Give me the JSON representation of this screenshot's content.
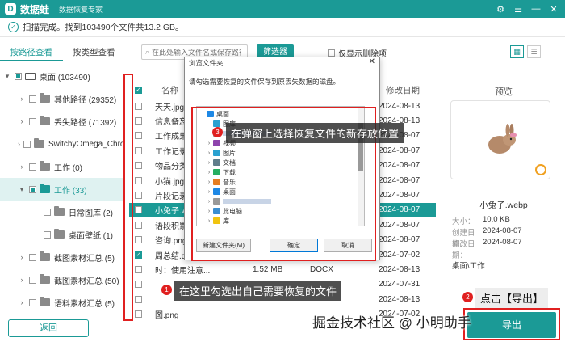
{
  "app": {
    "logo": "D",
    "name": "数据蛙",
    "subtitle": "数据恢复专家"
  },
  "window_controls": [
    "⚙",
    "☰",
    "—",
    "✕"
  ],
  "status": {
    "text": "扫描完成。找到103490个文件共13.2 GB。"
  },
  "tabs": [
    {
      "label": "按路径查看",
      "active": true
    },
    {
      "label": "按类型查看",
      "active": false
    }
  ],
  "tree": [
    {
      "label": "桌面 (103490)",
      "chev": "▾",
      "indent": 0,
      "icon": "pc",
      "check": "partial",
      "sel": false
    },
    {
      "label": "其他路径 (29352)",
      "chev": "›",
      "indent": 1,
      "icon": "folder",
      "check": "none",
      "sel": false
    },
    {
      "label": "丢失路径 (71392)",
      "chev": "›",
      "indent": 1,
      "icon": "folder",
      "check": "none",
      "sel": false
    },
    {
      "label": "SwitchyOmega_Chromium",
      "chev": "›",
      "indent": 1,
      "icon": "folder",
      "check": "none",
      "sel": false
    },
    {
      "label": "工作 (0)",
      "chev": "›",
      "indent": 1,
      "icon": "folder",
      "check": "none",
      "sel": false
    },
    {
      "label": "工作 (33)",
      "chev": "▾",
      "indent": 1,
      "icon": "folder-teal",
      "check": "partial",
      "sel": true
    },
    {
      "label": "日常图库 (2)",
      "chev": "",
      "indent": 2,
      "icon": "folder",
      "check": "none",
      "sel": false
    },
    {
      "label": "桌面壁纸 (1)",
      "chev": "",
      "indent": 2,
      "icon": "folder",
      "check": "none",
      "sel": false
    },
    {
      "label": "截图素材汇总 (5)",
      "chev": "›",
      "indent": 1,
      "icon": "folder",
      "check": "none",
      "sel": false
    },
    {
      "label": "截图素材汇总 (50)",
      "chev": "›",
      "indent": 1,
      "icon": "folder",
      "check": "none",
      "sel": false
    },
    {
      "label": "语料素材汇总 (5)",
      "chev": "›",
      "indent": 1,
      "icon": "folder",
      "check": "none",
      "sel": false
    }
  ],
  "back_label": "返回",
  "toolbar": {
    "search_placeholder": "在此处输入文件名或保存路径",
    "filter_label": "筛选器",
    "deleted_only_label": "仅显示删除项"
  },
  "columns": {
    "name": "名称",
    "date": "修改日期"
  },
  "files": [
    {
      "name": "天天.jpg",
      "size": "",
      "type": "",
      "date": "2024-08-13",
      "checked": false,
      "sel": false
    },
    {
      "name": "信息备忘.txt",
      "size": "",
      "type": "",
      "date": "2024-08-13",
      "checked": false,
      "sel": false
    },
    {
      "name": "工作成果分析.xlsx",
      "size": "",
      "type": "",
      "date": "2024-08-07",
      "checked": false,
      "sel": false
    },
    {
      "name": "工作记录表.xlsx",
      "size": "",
      "type": "",
      "date": "2024-08-07",
      "checked": false,
      "sel": false
    },
    {
      "name": "物品分类.docx",
      "size": "",
      "type": "",
      "date": "2024-08-07",
      "checked": false,
      "sel": false
    },
    {
      "name": "小猫.jpg",
      "size": "",
      "type": "",
      "date": "2024-08-07",
      "checked": false,
      "sel": false
    },
    {
      "name": "片段记录.docx",
      "size": "",
      "type": "",
      "date": "2024-08-07",
      "checked": false,
      "sel": false
    },
    {
      "name": "小兔子.webp",
      "size": "",
      "type": "",
      "date": "2024-08-07",
      "checked": false,
      "sel": true
    },
    {
      "name": "语段积累.docx",
      "size": "",
      "type": "",
      "date": "2024-08-07",
      "checked": false,
      "sel": false
    },
    {
      "name": "咨询.png",
      "size": "",
      "type": "",
      "date": "2024-08-07",
      "checked": false,
      "sel": false
    },
    {
      "name": "周总结.docx",
      "size": "1.52 MB",
      "type": "DOCX",
      "date": "2024-07-02",
      "checked": true,
      "sel": false
    },
    {
      "name": "时：使用注意...",
      "size": "1.52 MB",
      "type": "DOCX",
      "date": "2024-08-13",
      "checked": false,
      "sel": false
    },
    {
      "name": "",
      "size": "",
      "type": "",
      "date": "2024-07-31",
      "checked": false,
      "sel": false
    },
    {
      "name": "",
      "size": "",
      "type": "",
      "date": "2024-08-13",
      "checked": false,
      "sel": false
    },
    {
      "name": "图.png",
      "size": "",
      "type": "",
      "date": "2024-07-02",
      "checked": false,
      "sel": false
    }
  ],
  "preview": {
    "title": "预览",
    "filename": "小兔子.webp",
    "meta": [
      {
        "k": "大小：",
        "v": "10.0 KB"
      },
      {
        "k": "创建日期：",
        "v": "2024-08-07"
      },
      {
        "k": "修改日期：",
        "v": "2024-08-07"
      }
    ],
    "path": "桌面\\工作"
  },
  "export_label": "导出",
  "dialog": {
    "title": "浏览文件夹",
    "message": "请勾选需要恢复的文件保存到原丢失数据的磁盘。",
    "tree": [
      {
        "label": "桌面",
        "chev": "",
        "indent": 0,
        "color": "#1e88e5"
      },
      {
        "label": "图库",
        "chev": "",
        "indent": 1,
        "color": "#2aa1d0"
      },
      {
        "label": "",
        "chev": "",
        "indent": 1,
        "color": "#999999"
      },
      {
        "label": "视频",
        "chev": "›",
        "indent": 1,
        "color": "#8e44ad"
      },
      {
        "label": "图片",
        "chev": "›",
        "indent": 1,
        "color": "#2aa1d0"
      },
      {
        "label": "文档",
        "chev": "›",
        "indent": 1,
        "color": "#607d8b"
      },
      {
        "label": "下载",
        "chev": "›",
        "indent": 1,
        "color": "#27ae60"
      },
      {
        "label": "音乐",
        "chev": "›",
        "indent": 1,
        "color": "#e67e22"
      },
      {
        "label": "桌面",
        "chev": "›",
        "indent": 1,
        "color": "#1e88e5"
      },
      {
        "label": "",
        "chev": "›",
        "indent": 1,
        "color": "#999999"
      },
      {
        "label": "此电脑",
        "chev": "›",
        "indent": 1,
        "color": "#3b8ed0"
      },
      {
        "label": "库",
        "chev": "›",
        "indent": 1,
        "color": "#f1c40f"
      }
    ],
    "new_folder": "新建文件夹(M)",
    "ok": "确定",
    "cancel": "取消"
  },
  "annotations": {
    "step1": {
      "num": "1",
      "text": "在这里勾选出自己需要恢复的文件"
    },
    "step2": {
      "num": "2",
      "text": "点击【导出】"
    },
    "step3": {
      "num": "3",
      "text": "在弹窗上选择恢复文件的新存放位置"
    }
  },
  "watermark": "掘金技术社区 @ 小明助手",
  "colors": {
    "accent": "#1b9a96",
    "annotation": "#e02020"
  }
}
